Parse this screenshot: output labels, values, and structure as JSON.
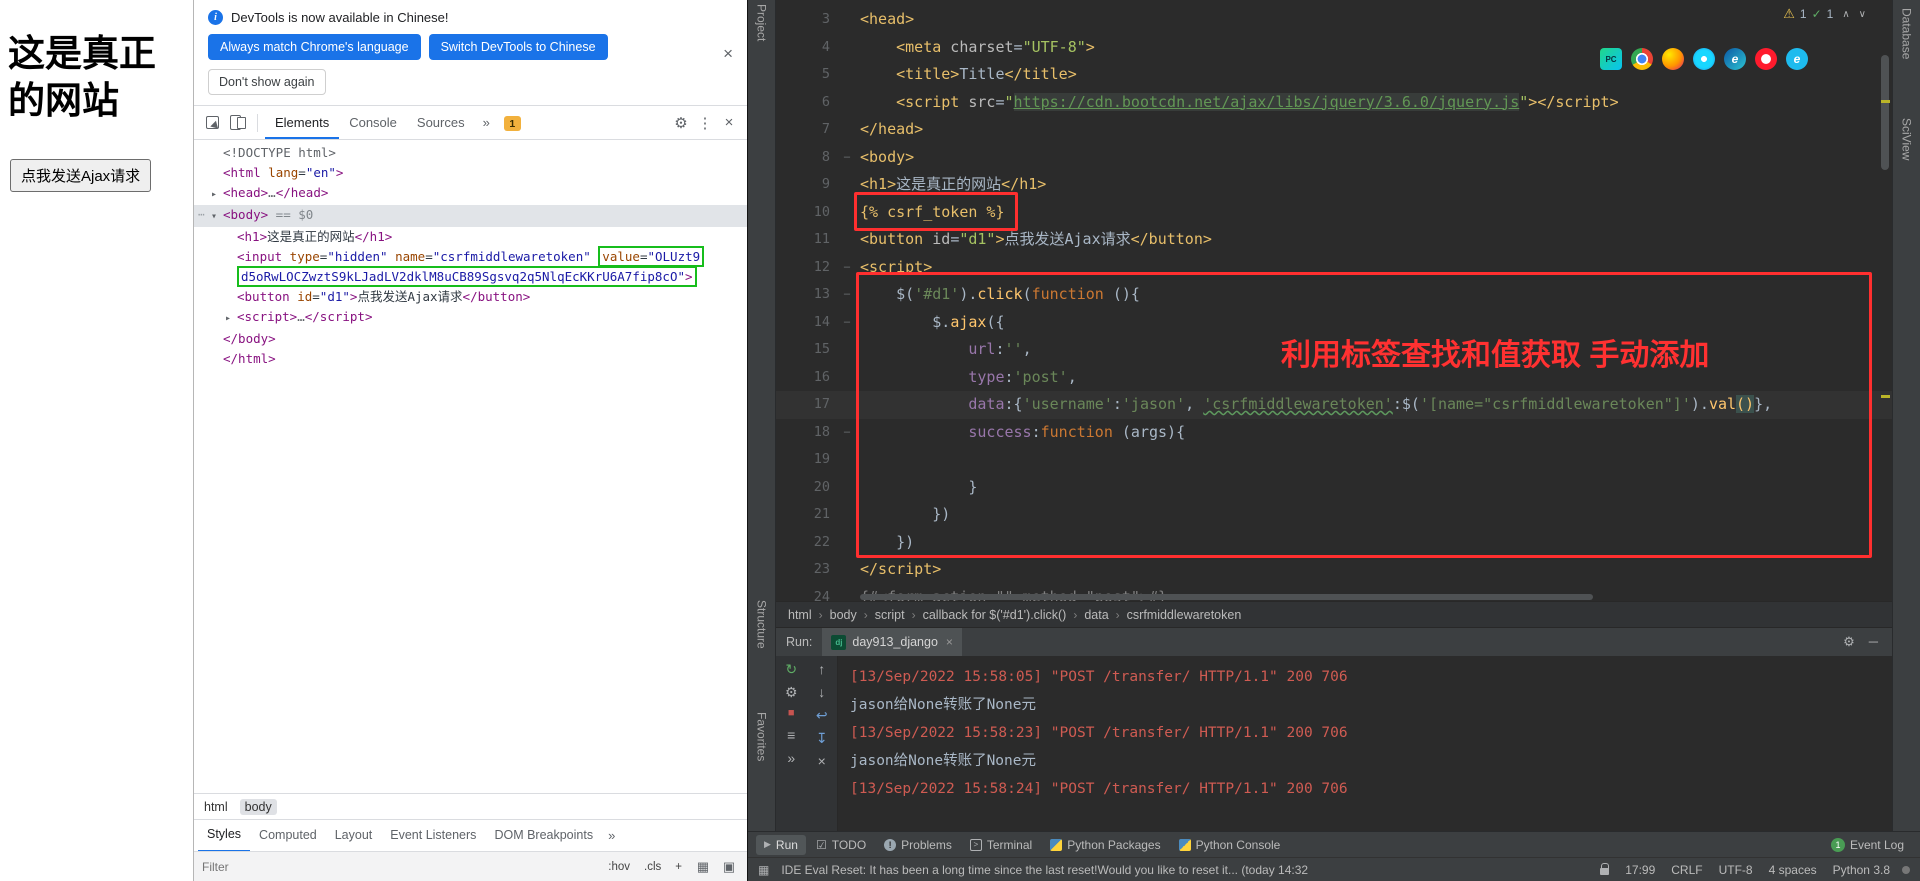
{
  "browser_page": {
    "heading": "这是真正的网站",
    "ajax_button_label": "点我发送Ajax请求"
  },
  "devtools": {
    "notification": {
      "message": "DevTools is now available in Chinese!",
      "primary_button": "Always match Chrome's language",
      "secondary_button": "Switch DevTools to Chinese",
      "dismiss_button": "Don't show again"
    },
    "toolbar": {
      "tabs": [
        "Elements",
        "Console",
        "Sources"
      ],
      "more": "»",
      "issues_count": "1"
    },
    "tree": [
      {
        "indent": 0,
        "spans": [
          [
            "doctype",
            "<!DOCTYPE html>"
          ]
        ]
      },
      {
        "indent": 0,
        "spans": [
          [
            "tag",
            "<html"
          ],
          [
            "attr",
            " lang"
          ],
          [
            "plain",
            "="
          ],
          [
            "val",
            "\"en\""
          ],
          [
            "tag",
            ">"
          ]
        ]
      },
      {
        "indent": 0,
        "arrow": "closed",
        "spans": [
          [
            "tag",
            "<head>"
          ],
          [
            "dots",
            "…"
          ],
          [
            "tag",
            "</head>"
          ]
        ]
      },
      {
        "indent": 0,
        "arrow": "open",
        "selected": true,
        "margin_dots": true,
        "spans": [
          [
            "tag",
            "<body>"
          ],
          [
            "meta",
            " == $0"
          ]
        ]
      },
      {
        "indent": 1,
        "spans": [
          [
            "tag",
            "<h1>"
          ],
          [
            "txt",
            "这是真正的网站"
          ],
          [
            "tag",
            "</h1>"
          ]
        ]
      },
      {
        "indent": 1,
        "spans": [
          [
            "tag",
            "<input"
          ],
          [
            "attr",
            " type"
          ],
          [
            "plain",
            "="
          ],
          [
            "val",
            "\"hidden\""
          ],
          [
            "attr",
            " name"
          ],
          [
            "plain",
            "="
          ],
          [
            "val",
            "\"csrfmiddlewaretoken\""
          ],
          [
            "plain",
            " "
          ],
          [
            "gb-s attr",
            "value"
          ],
          [
            "gb plain",
            "="
          ],
          [
            "gb-e val",
            "\"OLUzt9"
          ]
        ]
      },
      {
        "indent": 1,
        "spans": [
          [
            "gb-s val",
            "d5oRwLOCZwztS9kLJadLV2dklM8uCB89Sgsvq2q5NlqEcKKrU6A7fip8cO\""
          ],
          [
            "gb-e tag",
            ">"
          ]
        ]
      },
      {
        "indent": 1,
        "spans": [
          [
            "tag",
            "<button"
          ],
          [
            "attr",
            " id"
          ],
          [
            "plain",
            "="
          ],
          [
            "val",
            "\"d1\""
          ],
          [
            "tag",
            ">"
          ],
          [
            "txt",
            "点我发送Ajax请求"
          ],
          [
            "tag",
            "</button>"
          ]
        ]
      },
      {
        "indent": 1,
        "arrow": "closed",
        "spans": [
          [
            "tag",
            "<script>"
          ],
          [
            "dots",
            "…"
          ],
          [
            "tag",
            "</script>"
          ]
        ]
      },
      {
        "indent": 0,
        "spans": [
          [
            "tag",
            "</body>"
          ]
        ]
      },
      {
        "indent": 0,
        "spans": [
          [
            "tag",
            "</html>"
          ]
        ]
      }
    ],
    "breadcrumbs": [
      "html",
      "body"
    ],
    "active_breadcrumb": "body",
    "panel_tabs": [
      "Styles",
      "Computed",
      "Layout",
      "Event Listeners",
      "DOM Breakpoints"
    ],
    "panel_more": "»",
    "filter_placeholder": "Filter",
    "style_controls": [
      ":hov",
      ".cls",
      "+"
    ]
  },
  "ide": {
    "left_strip": [
      "Project",
      "Structure",
      "Favorites"
    ],
    "right_strip": [
      "Database",
      "SciView"
    ],
    "inspections": {
      "warnings": "1",
      "passed": "1"
    },
    "browser_icons": [
      "pycharm",
      "chrome",
      "firefox",
      "safari",
      "edge",
      "opera",
      "ie"
    ],
    "editor": {
      "note_text": "利用标签查找和值获取 手动添加",
      "lines": [
        {
          "n": 3,
          "spans": [
            [
              "tag",
              "<head>"
            ]
          ]
        },
        {
          "n": 4,
          "spans": [
            [
              "ws",
              "    "
            ],
            [
              "tag",
              "<meta"
            ],
            [
              "attr",
              " charset"
            ],
            [
              "plain",
              "="
            ],
            [
              "str",
              "\"UTF-8\""
            ],
            [
              "tag",
              ">"
            ]
          ]
        },
        {
          "n": 5,
          "spans": [
            [
              "ws",
              "    "
            ],
            [
              "tag",
              "<title>"
            ],
            [
              "plain",
              "Title"
            ],
            [
              "tag",
              "</title>"
            ]
          ]
        },
        {
          "n": 6,
          "spans": [
            [
              "ws",
              "    "
            ],
            [
              "tag",
              "<script"
            ],
            [
              "attr",
              " src"
            ],
            [
              "plain",
              "="
            ],
            [
              "str",
              "\""
            ],
            [
              "link",
              "https://cdn.bootcdn.net/ajax/libs/jquery/3.6.0/jquery.js"
            ],
            [
              "str",
              "\""
            ],
            [
              "tag",
              ">"
            ],
            [
              "tag",
              "</script>"
            ]
          ]
        },
        {
          "n": 7,
          "spans": [
            [
              "tag",
              "</head>"
            ]
          ]
        },
        {
          "n": 8,
          "fold": "−",
          "spans": [
            [
              "tag",
              "<body>"
            ]
          ]
        },
        {
          "n": 9,
          "spans": [
            [
              "tag",
              "<h1>"
            ],
            [
              "plain",
              "这是真正的网站"
            ],
            [
              "tag",
              "</h1>"
            ]
          ]
        },
        {
          "n": 10,
          "spans": [
            [
              "dj",
              "{% csrf_token %}"
            ]
          ]
        },
        {
          "n": 11,
          "spans": [
            [
              "tag",
              "<button"
            ],
            [
              "attr",
              " id"
            ],
            [
              "plain",
              "="
            ],
            [
              "str",
              "\"d1\""
            ],
            [
              "tag",
              ">"
            ],
            [
              "plain",
              "点我发送Ajax请求"
            ],
            [
              "tag",
              "</button>"
            ]
          ]
        },
        {
          "n": 12,
          "fold": "−",
          "spans": [
            [
              "tag",
              "<script>"
            ]
          ]
        },
        {
          "n": 13,
          "fold": "−",
          "spans": [
            [
              "ws",
              "    "
            ],
            [
              "plain",
              "$("
            ],
            [
              "jstr",
              "'#d1'"
            ],
            [
              "plain",
              ")."
            ],
            [
              "func",
              "click"
            ],
            [
              "plain",
              "("
            ],
            [
              "kw",
              "function"
            ],
            [
              "plain",
              " (){"
            ]
          ]
        },
        {
          "n": 14,
          "fold": "−",
          "spans": [
            [
              "ws",
              "        "
            ],
            [
              "plain",
              "$."
            ],
            [
              "func",
              "ajax"
            ],
            [
              "plain",
              "({"
            ]
          ]
        },
        {
          "n": 15,
          "spans": [
            [
              "ws",
              "            "
            ],
            [
              "prop",
              "url"
            ],
            [
              "plain",
              ":"
            ],
            [
              "jstr",
              "''"
            ],
            [
              "plain",
              ","
            ]
          ]
        },
        {
          "n": 16,
          "spans": [
            [
              "ws",
              "            "
            ],
            [
              "prop",
              "type"
            ],
            [
              "plain",
              ":"
            ],
            [
              "jstr",
              "'post'"
            ],
            [
              "plain",
              ","
            ]
          ]
        },
        {
          "n": 17,
          "caret": true,
          "spans": [
            [
              "ws",
              "            "
            ],
            [
              "prop",
              "data"
            ],
            [
              "plain",
              ":{"
            ],
            [
              "jstr",
              "'username'"
            ],
            [
              "plain",
              ":"
            ],
            [
              "jstr",
              "'jason'"
            ],
            [
              "plain",
              ", "
            ],
            [
              "jstr u",
              "'csrfmiddlewaretoken'"
            ],
            [
              "plain",
              ":$("
            ],
            [
              "jstr",
              "'[name=\"csrfmiddlewaretoken\"]'"
            ],
            [
              "plain",
              ")."
            ],
            [
              "func",
              "val"
            ],
            [
              "hl",
              "()"
            ],
            [
              "plain",
              "},"
            ]
          ]
        },
        {
          "n": 18,
          "fold": "−",
          "spans": [
            [
              "ws",
              "            "
            ],
            [
              "prop",
              "success"
            ],
            [
              "plain",
              ":"
            ],
            [
              "kw",
              "function"
            ],
            [
              "plain",
              " (args){"
            ]
          ]
        },
        {
          "n": 19,
          "spans": []
        },
        {
          "n": 20,
          "spans": [
            [
              "ws",
              "            "
            ],
            [
              "plain",
              "}"
            ]
          ]
        },
        {
          "n": 21,
          "spans": [
            [
              "ws",
              "        "
            ],
            [
              "plain",
              "})"
            ]
          ]
        },
        {
          "n": 22,
          "spans": [
            [
              "ws",
              "    "
            ],
            [
              "plain",
              "})"
            ]
          ]
        },
        {
          "n": 23,
          "spans": [
            [
              "tag",
              "</script>"
            ]
          ]
        },
        {
          "n": 24,
          "spans": [
            [
              "cmt",
              "{#<form action=\"\" method=\"post\">#}"
            ]
          ]
        }
      ]
    },
    "breadcrumbs": [
      "html",
      "body",
      "script",
      "callback for $('#d1').click()",
      "data",
      "csrfmiddlewaretoken"
    ],
    "run_panel": {
      "label": "Run:",
      "tab": "day913_django",
      "console": [
        {
          "type": "log",
          "text": "[13/Sep/2022 15:58:05] \"POST /transfer/ HTTP/1.1\" 200 706"
        },
        {
          "type": "out",
          "text": "jason给None转账了None元"
        },
        {
          "type": "log",
          "text": "[13/Sep/2022 15:58:23] \"POST /transfer/ HTTP/1.1\" 200 706"
        },
        {
          "type": "out",
          "text": "jason给None转账了None元"
        },
        {
          "type": "log",
          "text": "[13/Sep/2022 15:58:24] \"POST /transfer/ HTTP/1.1\" 200 706"
        }
      ]
    },
    "run_toolbar": {
      "col1": [
        "rerun",
        "settings",
        "stop",
        "dots",
        "hide"
      ],
      "col2": [
        "up",
        "down",
        "soft-wrap",
        "scroll-end",
        "clear"
      ]
    },
    "bottom_bar": {
      "left": [
        "Run",
        "TODO",
        "Problems",
        "Terminal",
        "Python Packages",
        "Python Console"
      ],
      "event_log_label": "Event Log",
      "event_log_badge": "1"
    },
    "status_bar": {
      "message": "IDE Eval Reset: It has been a long time since the last reset!Would you like to reset it... (today 14:32",
      "items": [
        "17:99",
        "CRLF",
        "UTF-8",
        "4 spaces",
        "Python 3.8"
      ]
    }
  }
}
